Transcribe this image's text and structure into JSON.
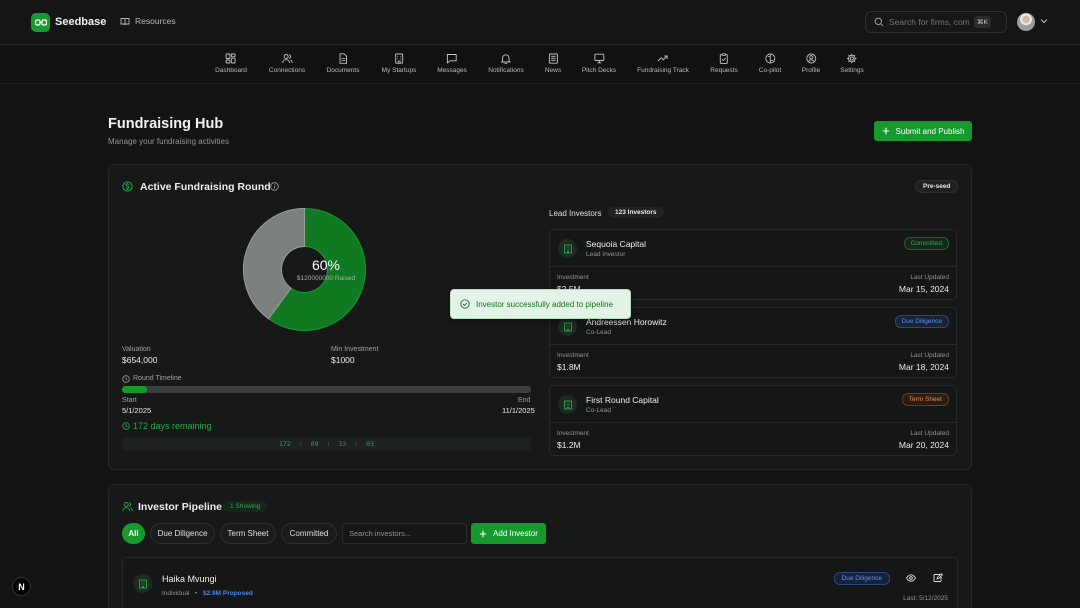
{
  "app": {
    "brand": "Seedbase",
    "resources": "Resources"
  },
  "search": {
    "placeholder": "Search for firms, com...",
    "shortcut": "⌘K"
  },
  "nav": [
    {
      "label": "Dashboard",
      "icon": "dashboard-icon"
    },
    {
      "label": "Connections",
      "icon": "users-icon"
    },
    {
      "label": "Documents",
      "icon": "document-icon"
    },
    {
      "label": "My Startups",
      "icon": "building-icon"
    },
    {
      "label": "Messages",
      "icon": "message-icon"
    },
    {
      "label": "Notifications",
      "icon": "bell-icon"
    },
    {
      "label": "News",
      "icon": "newspaper-icon"
    },
    {
      "label": "Pitch Decks",
      "icon": "presentation-icon"
    },
    {
      "label": "Fundraising Track",
      "icon": "trending-up-icon"
    },
    {
      "label": "Requests",
      "icon": "clipboard-icon"
    },
    {
      "label": "Co-pilot",
      "icon": "brain-icon"
    },
    {
      "label": "Profile",
      "icon": "user-circle-icon"
    },
    {
      "label": "Settings",
      "icon": "gear-icon"
    }
  ],
  "page": {
    "title": "Fundraising Hub",
    "subtitle": "Manage your fundraising activities",
    "submit_label": "Submit and Publish"
  },
  "round": {
    "title": "Active Fundraising Round",
    "stage": "Pre-seed",
    "percent_label": "60%",
    "percent": 0.6,
    "raised_label": "$120000000 Raised",
    "valuation_label": "Valuation",
    "valuation": "$654,000",
    "min_investment_label": "Min Investment",
    "min_investment": "$1000",
    "timeline_label": "Round Timeline",
    "timeline_progress": 0.06,
    "start_label": "Start",
    "start": "5/1/2025",
    "end_label": "End",
    "end": "11/1/2025",
    "days_remaining": "172 days remaining",
    "countdown": [
      "172",
      ":",
      "09",
      ":",
      "33",
      ":",
      "03"
    ]
  },
  "lead_investors": {
    "title": "Lead Investors",
    "count": "123 Investors",
    "investment_label": "Investment",
    "updated_label": "Last Updated",
    "items": [
      {
        "name": "Sequoia Capital",
        "role": "Lead Investor",
        "status": "Committed",
        "investment": "$2.5M",
        "updated": "Mar 15, 2024"
      },
      {
        "name": "Andreessen Horowitz",
        "role": "Co-Lead",
        "status": "Due Diligence",
        "investment": "$1.8M",
        "updated": "Mar 18, 2024"
      },
      {
        "name": "First Round Capital",
        "role": "Co-Lead",
        "status": "Term Sheet",
        "investment": "$1.2M",
        "updated": "Mar 20, 2024"
      }
    ]
  },
  "toast": {
    "message": "Investor successfully added to pipeline"
  },
  "pipeline": {
    "title": "Investor Pipeline",
    "showing": "1 Showing",
    "filters": [
      "All",
      "Due Diligence",
      "Term Sheet",
      "Committed"
    ],
    "search_placeholder": "Search investors...",
    "add_label": "Add Investor",
    "row": {
      "name": "Haika Mvungi",
      "type": "Individual",
      "separator": "•",
      "amount": "$2.9M Proposed",
      "status": "Due Diligence",
      "last_date": "Last: 5/12/2025"
    }
  },
  "dev_badge": "N",
  "colors": {
    "accent": "#169a2d",
    "background": "#121313",
    "card": "#171918",
    "blue": "#4a86e8",
    "orange": "#e07b39"
  }
}
